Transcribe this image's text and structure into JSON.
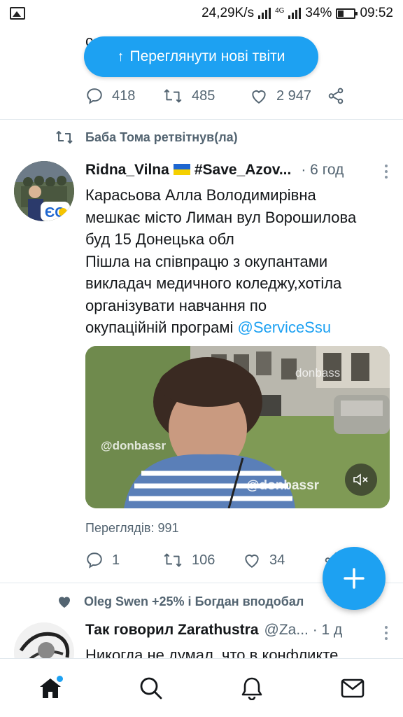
{
  "status_bar": {
    "speed": "24,29K/s",
    "network": "4G",
    "battery": "34%",
    "time": "09:52"
  },
  "new_tweets_pill": {
    "label": "Переглянути нові твіти",
    "icon": "arrow-up-icon"
  },
  "previous_tweet": {
    "partial_text": "с                  чно саму",
    "replies": "418",
    "retweets": "485",
    "likes": "2 947"
  },
  "tweet": {
    "retweeted_by": "Баба Тома ретвітнув(ла)",
    "author_name": "Ridna_Vilna",
    "author_tag": "#Save_Azov...",
    "author_flag": "ukrainian-flag-icon",
    "time": "· 6 год",
    "body_lines": [
      "Карасьова Алла Володимирівна",
      "мешкає місто Лиман вул Ворошилова",
      "буд 15 Донецька обл",
      "Пішла на співпрацю з окупантами",
      "викладач медичного коледжу,хотіла",
      "організувати  навчання по"
    ],
    "body_last_line_text": "окупаційній програмі ",
    "mention": "@ServiceSsu",
    "avatar_badge": "ЄС",
    "media": {
      "watermark_main": "@donbassr",
      "watermark_small": "@donbassr",
      "watermark_top": "donbass"
    },
    "views": "Переглядів: 991",
    "replies": "1",
    "retweets": "106",
    "likes": "34"
  },
  "next_tweet": {
    "liked_by": "Oleg Swen +25% і Богдан вподобал",
    "author_name": "Так говорил Zarathustra",
    "handle": "@Za...  · 1 д",
    "partial_text": "Никогда не думал, что в конфликте"
  },
  "bottom_nav": {
    "items": [
      "home-icon",
      "search-icon",
      "notifications-icon",
      "messages-icon"
    ]
  },
  "colors": {
    "accent": "#1da1f2",
    "text": "#14171a",
    "secondary": "#536471",
    "divider": "#e1e8ed"
  }
}
